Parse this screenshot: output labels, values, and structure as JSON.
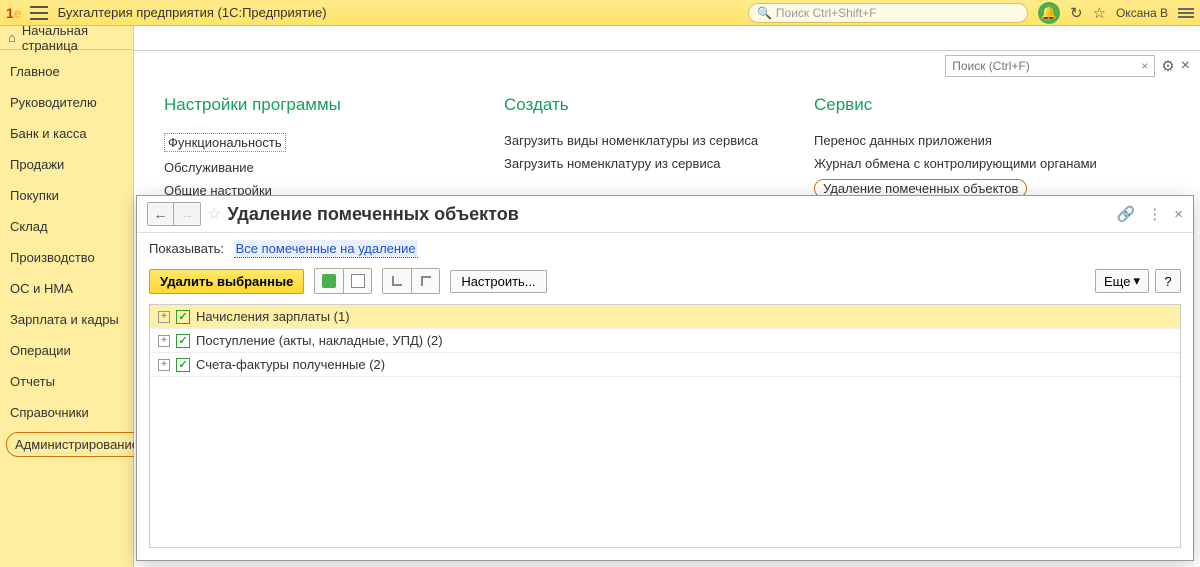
{
  "titlebar": {
    "app_title": "Бухгалтерия предприятия  (1С:Предприятие)",
    "search_placeholder": "Поиск Ctrl+Shift+F",
    "user": "Оксана В"
  },
  "startbar": {
    "label": "Начальная страница"
  },
  "sidebar": {
    "items": [
      "Главное",
      "Руководителю",
      "Банк и касса",
      "Продажи",
      "Покупки",
      "Склад",
      "Производство",
      "ОС и НМА",
      "Зарплата и кадры",
      "Операции",
      "Отчеты",
      "Справочники",
      "Администрирование"
    ]
  },
  "panel": {
    "search_placeholder": "Поиск (Ctrl+F)",
    "col1": {
      "title": "Настройки программы",
      "items": [
        "Функциональность",
        "Обслуживание",
        "Общие настройки"
      ]
    },
    "col2": {
      "title": "Создать",
      "items": [
        "Загрузить виды номенклатуры из сервиса",
        "Загрузить номенклатуру из сервиса"
      ]
    },
    "col3": {
      "title": "Сервис",
      "items": [
        "Перенос данных приложения",
        "Журнал обмена с контролирующими органами",
        "Удаление помеченных объектов"
      ]
    }
  },
  "window": {
    "title": "Удаление помеченных объектов",
    "filter_label": "Показывать:",
    "filter_link": "Все помеченные на удаление",
    "btn_delete": "Удалить выбранные",
    "btn_configure": "Настроить...",
    "btn_more": "Еще",
    "btn_help": "?",
    "rows": [
      "Начисления зарплаты (1)",
      "Поступление (акты, накладные, УПД) (2)",
      "Счета-фактуры полученные (2)"
    ]
  }
}
